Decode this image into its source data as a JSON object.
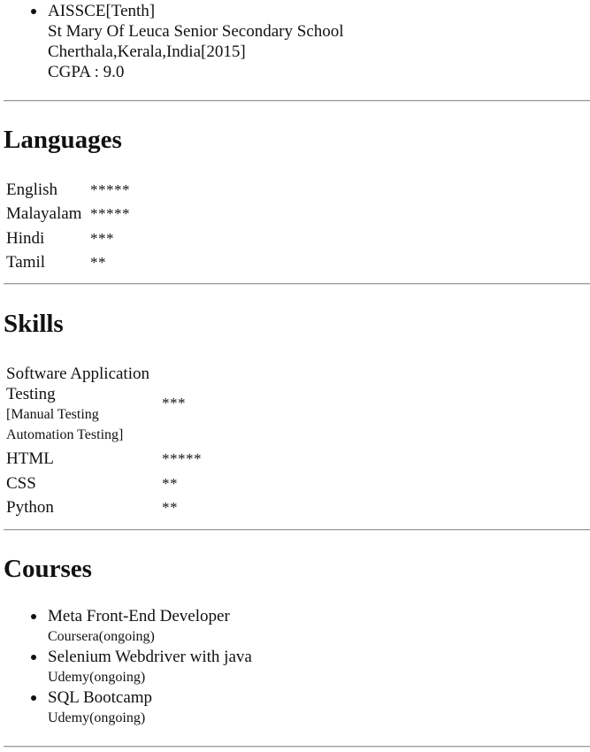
{
  "education": {
    "items": [
      {
        "title": "AISSCE[Tenth]",
        "school": "St Mary Of Leuca Senior Secondary School",
        "location": "Cherthala,Kerala,India[2015]",
        "grade": "CGPA : 9.0"
      }
    ]
  },
  "languages": {
    "heading": "Languages",
    "items": [
      {
        "name": "English",
        "rating": "*****"
      },
      {
        "name": "Malayalam",
        "rating": "*****"
      },
      {
        "name": "Hindi",
        "rating": "***"
      },
      {
        "name": "Tamil",
        "rating": "**"
      }
    ]
  },
  "skills": {
    "heading": "Skills",
    "items": [
      {
        "name_line1": "Software Application",
        "name_line2": "Testing",
        "detail_line1": "[Manual Testing",
        "detail_line2": "Automation Testing]",
        "rating": "***"
      },
      {
        "name": "HTML",
        "rating": "*****"
      },
      {
        "name": "CSS",
        "rating": "**"
      },
      {
        "name": "Python",
        "rating": "**"
      }
    ]
  },
  "courses": {
    "heading": "Courses",
    "items": [
      {
        "title": "Meta Front-End Developer",
        "provider": "Coursera(ongoing)"
      },
      {
        "title": "Selenium Webdriver with java",
        "provider": "Udemy(ongoing)"
      },
      {
        "title": "SQL Bootcamp",
        "provider": "Udemy(ongoing)"
      }
    ]
  }
}
